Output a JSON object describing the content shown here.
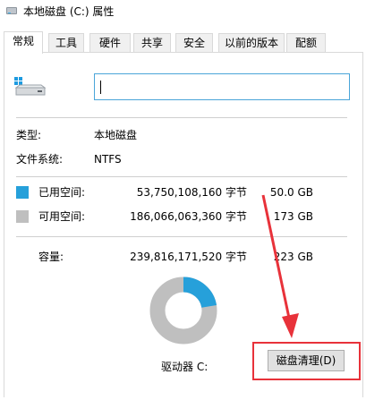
{
  "window": {
    "title": "本地磁盘 (C:) 属性"
  },
  "tabs": [
    {
      "label": "常规",
      "active": true
    },
    {
      "label": "工具",
      "active": false
    },
    {
      "label": "硬件",
      "active": false
    },
    {
      "label": "共享",
      "active": false
    },
    {
      "label": "安全",
      "active": false
    },
    {
      "label": "以前的版本",
      "active": false
    },
    {
      "label": "配额",
      "active": false
    }
  ],
  "general": {
    "name_value": "",
    "type_label": "类型:",
    "type_value": "本地磁盘",
    "fs_label": "文件系统:",
    "fs_value": "NTFS",
    "used_label": "已用空间:",
    "used_bytes": "53,750,108,160 字节",
    "used_size": "50.0 GB",
    "free_label": "可用空间:",
    "free_bytes": "186,066,063,360 字节",
    "free_size": "173 GB",
    "capacity_label": "容量:",
    "capacity_bytes": "239,816,171,520 字节",
    "capacity_size": "223 GB",
    "drive_label": "驱动器 C:",
    "cleanup_button": "磁盘清理(D)"
  },
  "usage": {
    "used_fraction": 0.224,
    "used_color": "#26a0da",
    "free_color": "#bfbfbf"
  },
  "annotation": {
    "color": "#e8323a"
  }
}
